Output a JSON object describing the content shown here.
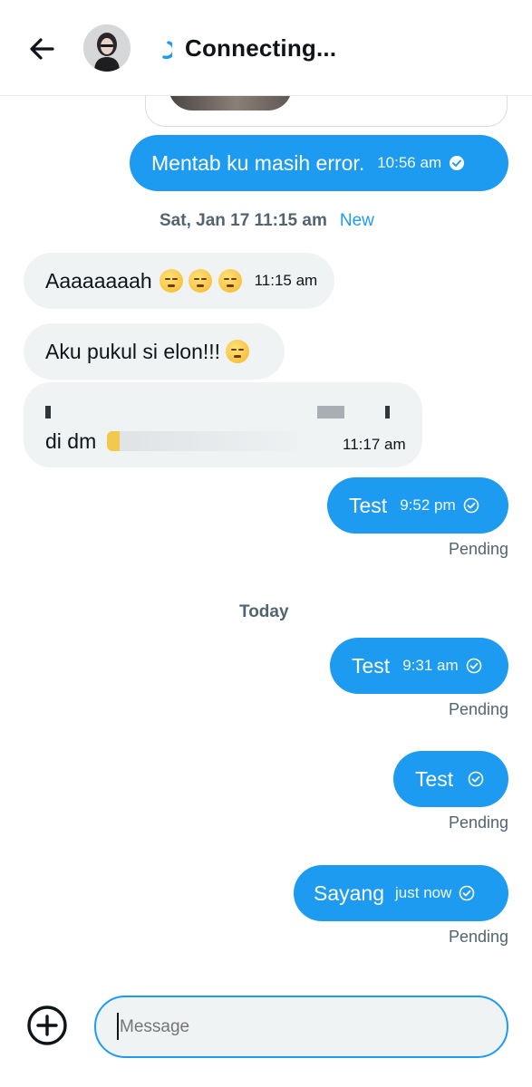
{
  "header": {
    "title": "Connecting...",
    "icons": [
      "back-arrow-icon",
      "avatar",
      "loading-spinner-icon"
    ]
  },
  "messages": [
    {
      "id": "m1",
      "direction": "out",
      "text": "Mentab ku masih error.",
      "time": "10:56 am",
      "receipt": "read"
    },
    {
      "id": "m2",
      "direction": "in",
      "text": "Aaaaaaaah",
      "emojis": [
        "weary-face",
        "pensive-face",
        "relieved-face"
      ],
      "time": "11:15 am"
    },
    {
      "id": "m3",
      "direction": "in",
      "text": "Aku pukul si elon!!!",
      "emojis": [
        "face-with-steam"
      ]
    },
    {
      "id": "m4",
      "direction": "in",
      "text": "di dm",
      "obscured": true,
      "time": "11:17 am"
    },
    {
      "id": "m5",
      "direction": "out",
      "text": "Test",
      "time": "9:52 pm",
      "receipt": "sent",
      "status": "Pending"
    },
    {
      "id": "m6",
      "direction": "out",
      "text": "Test",
      "time": "9:31 am",
      "receipt": "sent",
      "status": "Pending"
    },
    {
      "id": "m7",
      "direction": "out",
      "text": "Test",
      "time": "",
      "receipt": "sent",
      "status": "Pending"
    },
    {
      "id": "m8",
      "direction": "out",
      "text": "Sayang",
      "time": "just now",
      "receipt": "sent",
      "status": "Pending"
    }
  ],
  "separators": {
    "first": {
      "date": "Sat, Jan 17 11:15 am",
      "badge": "New"
    },
    "second": {
      "date": "Today"
    }
  },
  "composer": {
    "placeholder": "Message",
    "icons": [
      "add-circle-icon"
    ]
  },
  "colors": {
    "accent": "#1d9bf0",
    "incoming_bubble": "#eff3f4",
    "text": "#0f1419",
    "muted": "#536471"
  }
}
